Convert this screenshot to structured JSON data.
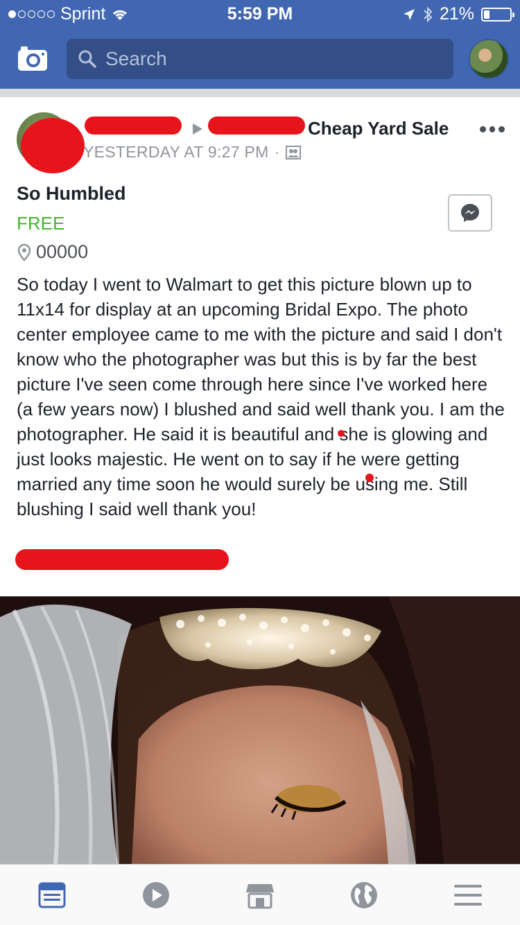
{
  "status_bar": {
    "carrier": "Sprint",
    "time": "5:59 PM",
    "battery": "21%",
    "battery_fraction": 0.21
  },
  "nav": {
    "search_placeholder": "Search"
  },
  "post": {
    "title_suffix": "Cheap Yard Sale",
    "timestamp": "YESTERDAY AT 9:27 PM",
    "audience_icon": "group-icon",
    "sale_title": "So Humbled",
    "price": "FREE",
    "location": "00000",
    "body": "So today I went to Walmart to get this picture blown up to 11x14 for display at an upcoming Bridal Expo. The photo center employee came to me with the picture and said I don't know who the photographer was but this is by far the best picture I've seen come through here since I've worked here (a few years now) I blushed and said well thank you. I am the photographer. He said it is beautiful and she is glowing and just looks majestic. He went on to say if he were getting married any time soon he would surely be using me. Still blushing I said well thank you!"
  },
  "tab_bar": {
    "items": [
      "news-feed-icon",
      "video-icon",
      "marketplace-icon",
      "globe-icon",
      "menu-icon"
    ],
    "active_color": "#4267b2",
    "inactive_color": "#90949c"
  },
  "colors": {
    "brand": "#4267b2",
    "price": "#42b72a",
    "redaction": "#e8141b"
  }
}
